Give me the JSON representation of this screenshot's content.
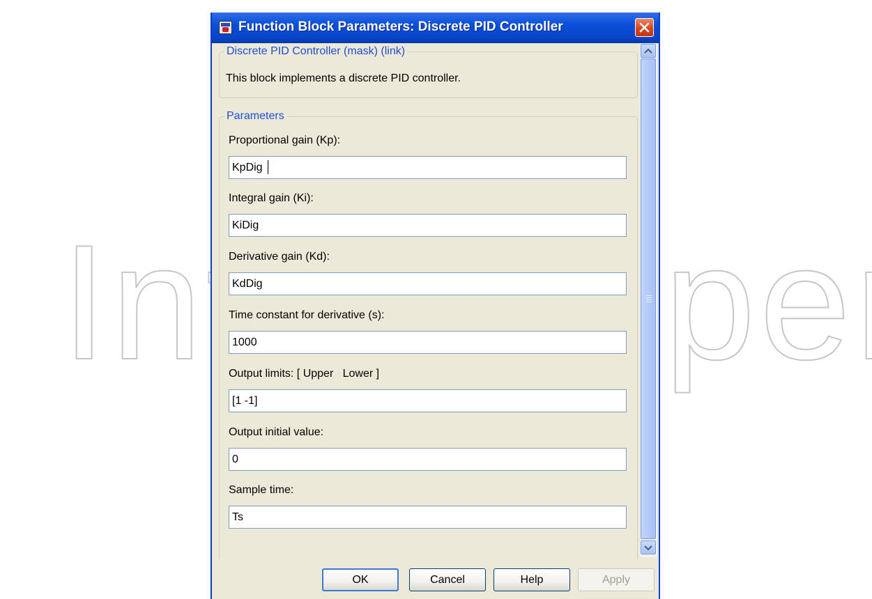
{
  "window": {
    "title": "Function Block Parameters: Discrete PID Controller",
    "app_icon": "simulink-block-icon",
    "close_icon": "close-x-icon"
  },
  "description_group": {
    "legend": "Discrete PID Controller (mask) (link)",
    "text": "This block implements a discrete PID controller."
  },
  "parameters_group": {
    "legend": "Parameters",
    "fields": [
      {
        "label": "Proportional gain (Kp):",
        "value": "KpDig"
      },
      {
        "label": "Integral gain (Ki):",
        "value": "KiDig"
      },
      {
        "label": "Derivative gain (Kd):",
        "value": "KdDig"
      },
      {
        "label": "Time constant for derivative (s):",
        "value": "1000"
      },
      {
        "label": "Output limits: [ Upper   Lower ]",
        "value": "[1 -1]"
      },
      {
        "label": "Output initial value:",
        "value": "0"
      },
      {
        "label": "Sample time:",
        "value": "Ts"
      }
    ]
  },
  "buttons": {
    "ok": "OK",
    "cancel": "Cancel",
    "help": "Help",
    "apply": "Apply"
  },
  "scrollbar": {
    "up_icon": "scroll-up-arrow-icon",
    "down_icon": "scroll-down-arrow-icon"
  },
  "watermark": {
    "text": "IntechOpen"
  },
  "colors": {
    "titlebar": "#0a4fd8",
    "dialog_face": "#ece9d8",
    "legend_text": "#1c4fd0",
    "close_button": "#d8461f"
  }
}
